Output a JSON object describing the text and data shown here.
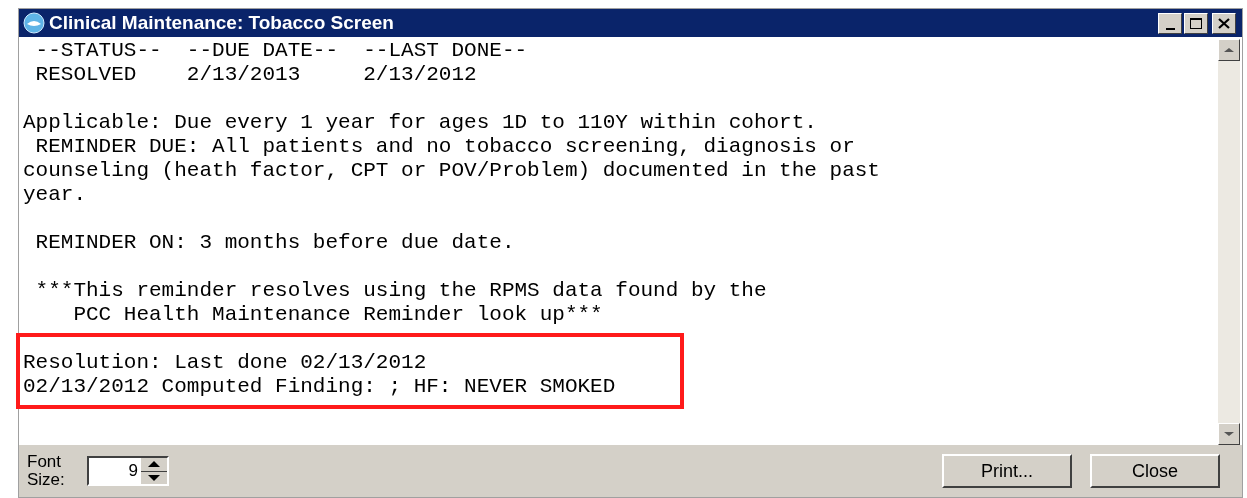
{
  "window": {
    "title": "Clinical Maintenance: Tobacco Screen"
  },
  "blocks": [
    {
      "highlighted": false,
      "lines": [
        " --STATUS--  --DUE DATE--  --LAST DONE--",
        " RESOLVED    2/13/2013     2/13/2012"
      ]
    },
    {
      "highlighted": false,
      "lines": [
        "Applicable: Due every 1 year for ages 1D to 110Y within cohort.",
        " REMINDER DUE: All patients and no tobacco screening, diagnosis or",
        "counseling (heath factor, CPT or POV/Problem) documented in the past",
        "year."
      ]
    },
    {
      "highlighted": false,
      "lines": [
        " REMINDER ON: 3 months before due date."
      ]
    },
    {
      "highlighted": false,
      "lines": [
        " ***This reminder resolves using the RPMS data found by the",
        "    PCC Health Maintenance Reminder look up***"
      ]
    },
    {
      "highlighted": true,
      "lines": [
        "Resolution: Last done 02/13/2012",
        "02/13/2012 Computed Finding: ; HF: NEVER SMOKED"
      ]
    }
  ],
  "font_size": {
    "label": "Font Size:",
    "value": "9"
  },
  "buttons": [
    "Print...",
    "Close"
  ]
}
